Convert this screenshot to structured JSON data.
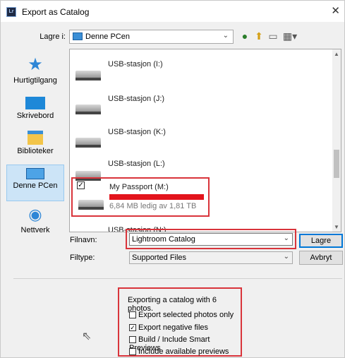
{
  "window": {
    "title": "Export as Catalog",
    "app_icon": "Lr"
  },
  "location": {
    "label": "Lagre i:",
    "value": "Denne PCen"
  },
  "places": [
    {
      "label": "Hurtigtilgang",
      "icon": "star-icon"
    },
    {
      "label": "Skrivebord",
      "icon": "desktop-icon"
    },
    {
      "label": "Biblioteker",
      "icon": "library-icon"
    },
    {
      "label": "Denne PCen",
      "icon": "computer-icon"
    },
    {
      "label": "Nettverk",
      "icon": "network-icon"
    }
  ],
  "drives": [
    {
      "name": "USB-stasjon (I:)"
    },
    {
      "name": "USB-stasjon (J:)"
    },
    {
      "name": "USB-stasjon (K:)"
    },
    {
      "name": "USB-stasjon (L:)"
    }
  ],
  "selected_drive": {
    "name": "My Passport (M:)",
    "detail": "6,84 MB ledig av 1,81 TB"
  },
  "partial_drive": "USB-stasjon (N:)",
  "filename": {
    "label": "Filnavn:",
    "value": "Lightroom Catalog"
  },
  "filetype": {
    "label": "Filtype:",
    "value": "Supported Files"
  },
  "buttons": {
    "save": "Lagre",
    "cancel": "Avbryt"
  },
  "export_options": {
    "summary": "Exporting a catalog with 6 photos.",
    "items": [
      {
        "label": "Export selected photos only",
        "checked": false
      },
      {
        "label": "Export negative files",
        "checked": true
      },
      {
        "label": "Build / Include Smart Previews",
        "checked": false
      },
      {
        "label": "Include available previews",
        "checked": false
      }
    ]
  }
}
